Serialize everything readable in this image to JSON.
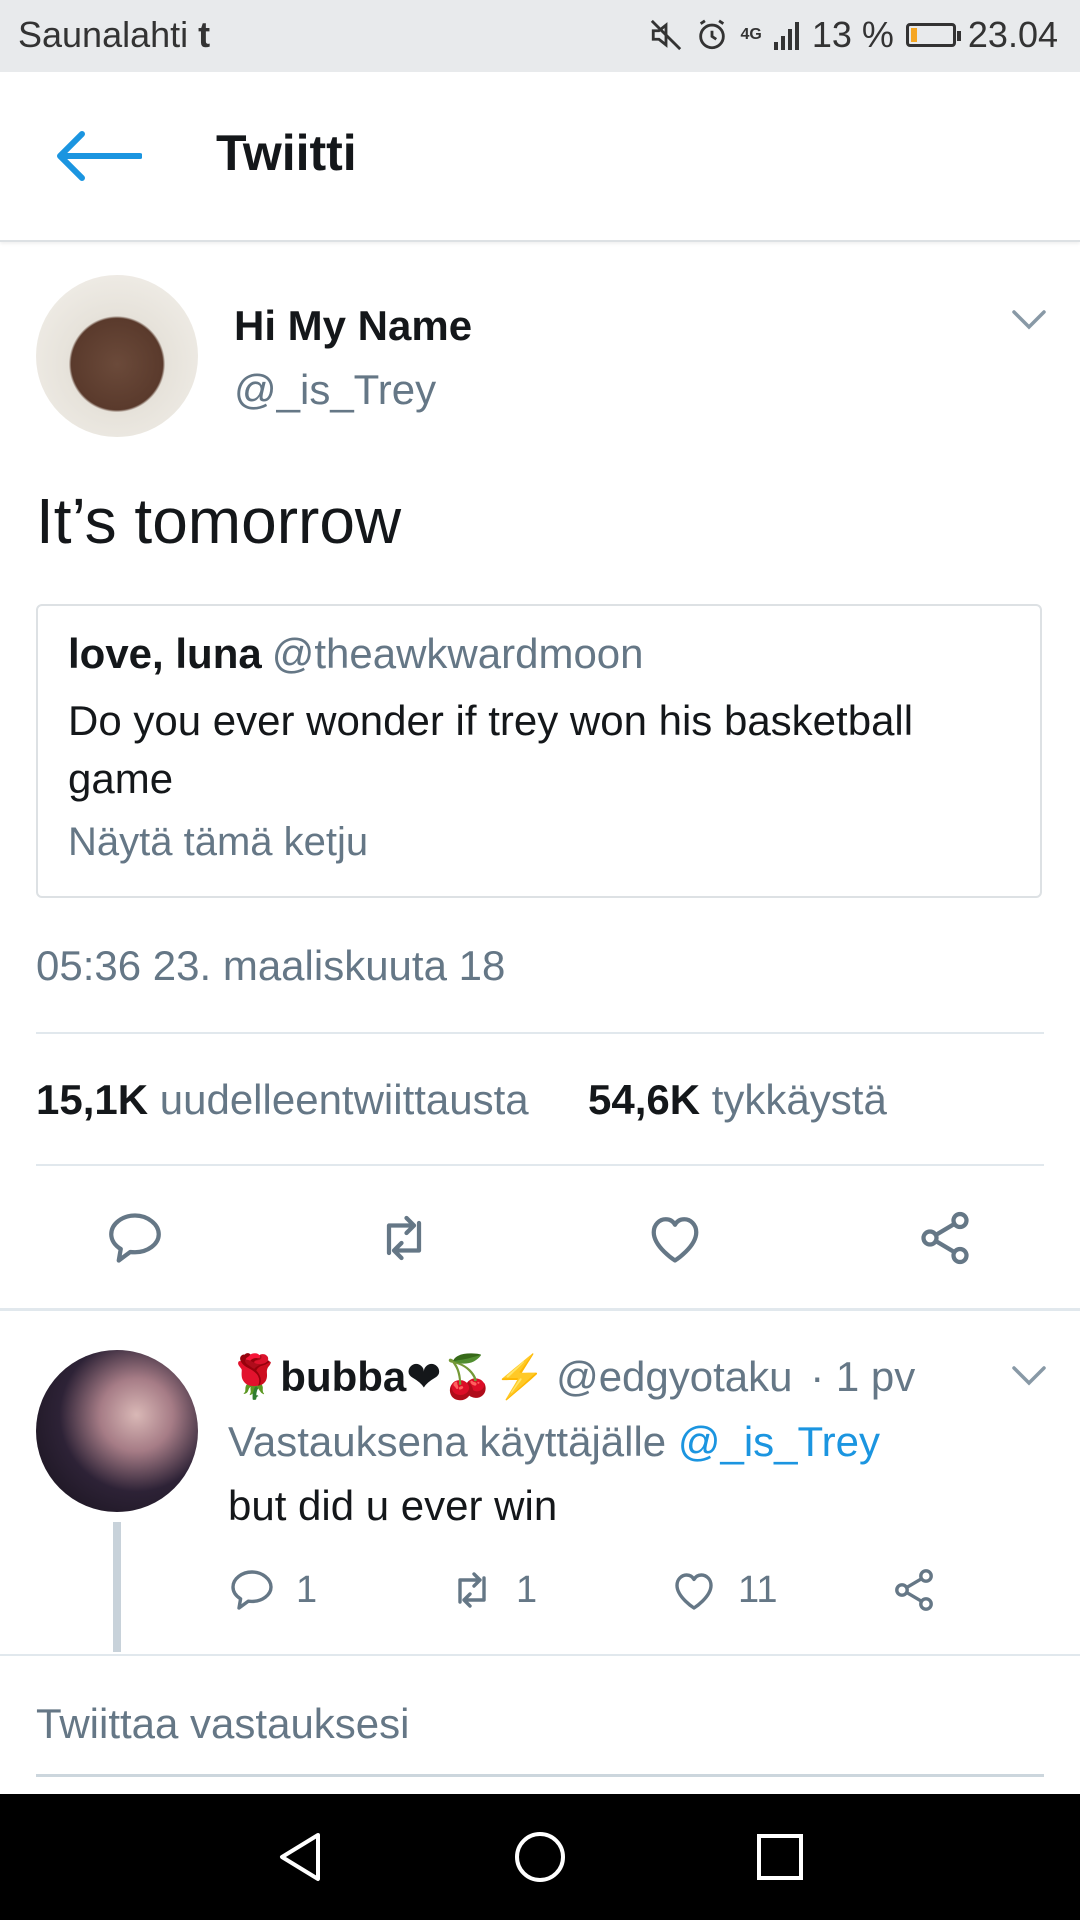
{
  "status_bar": {
    "carrier": "Saunalahti",
    "app_glyph": "t",
    "network": "4G",
    "battery_text": "13 %",
    "battery_level": 0.13,
    "time": "23.04",
    "icons": [
      "mute-icon",
      "alarm-icon",
      "signal-icon",
      "battery-icon"
    ]
  },
  "header": {
    "title": "Twiitti",
    "back_icon": "arrow-left-icon"
  },
  "tweet": {
    "display_name": "Hi My Name",
    "handle": "@_is_Trey",
    "text": "It’s tomorrow",
    "quote": {
      "name": "love, luna",
      "handle": "@theawkwardmoon",
      "text": "Do you ever wonder if trey won his basketball game",
      "show_thread": "Näytä tämä ketju"
    },
    "timestamp": "05:36 23. maaliskuuta 18",
    "retweets_count": "15,1K",
    "retweets_label": "uudelleentwiittausta",
    "likes_count": "54,6K",
    "likes_label": "tykkäystä"
  },
  "reply": {
    "name_prefix_emoji": "🌹",
    "name": "bubba",
    "name_suffix_emoji": "❤🍒⚡",
    "handle": "@edgyotaku",
    "time": "· 1 pv",
    "reply_to_label": "Vastauksena käyttäjälle",
    "reply_to_handle": "@_is_Trey",
    "text": "but did u ever win",
    "reply_count": "1",
    "retweet_count": "1",
    "like_count": "11"
  },
  "compose": {
    "placeholder": "Twiittaa vastauksesi"
  },
  "colors": {
    "accent": "#1b95e0",
    "secondary_text": "#657786",
    "divider": "#e1e8ed"
  }
}
